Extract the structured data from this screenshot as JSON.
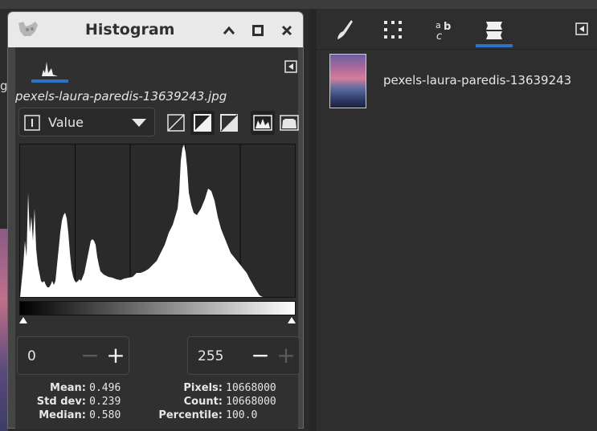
{
  "left_fragment": "g",
  "histogram": {
    "title": "Histogram",
    "tab_icon": "histogram-icon",
    "filename": "pexels-laura-paredis-13639243.jpg",
    "channel": "Value",
    "scale_modes": [
      "linear-histogram",
      "log-histogram"
    ],
    "range_start": "0",
    "range_end": "255",
    "stats": {
      "mean_label": "Mean:",
      "mean": "0.496",
      "stddev_label": "Std dev:",
      "stddev": "0.239",
      "median_label": "Median:",
      "median": "0.580",
      "pixels_label": "Pixels:",
      "pixels": "10668000",
      "count_label": "Count:",
      "count": "10668000",
      "percentile_label": "Percentile:",
      "percentile": "100.0"
    }
  },
  "dock": {
    "tabs": [
      "brushes-icon",
      "selection-icon",
      "text-icon",
      "layers-icon"
    ],
    "active_tab": "layers-icon",
    "images": [
      {
        "name": "pexels-laura-paredis-13639243"
      }
    ]
  }
}
